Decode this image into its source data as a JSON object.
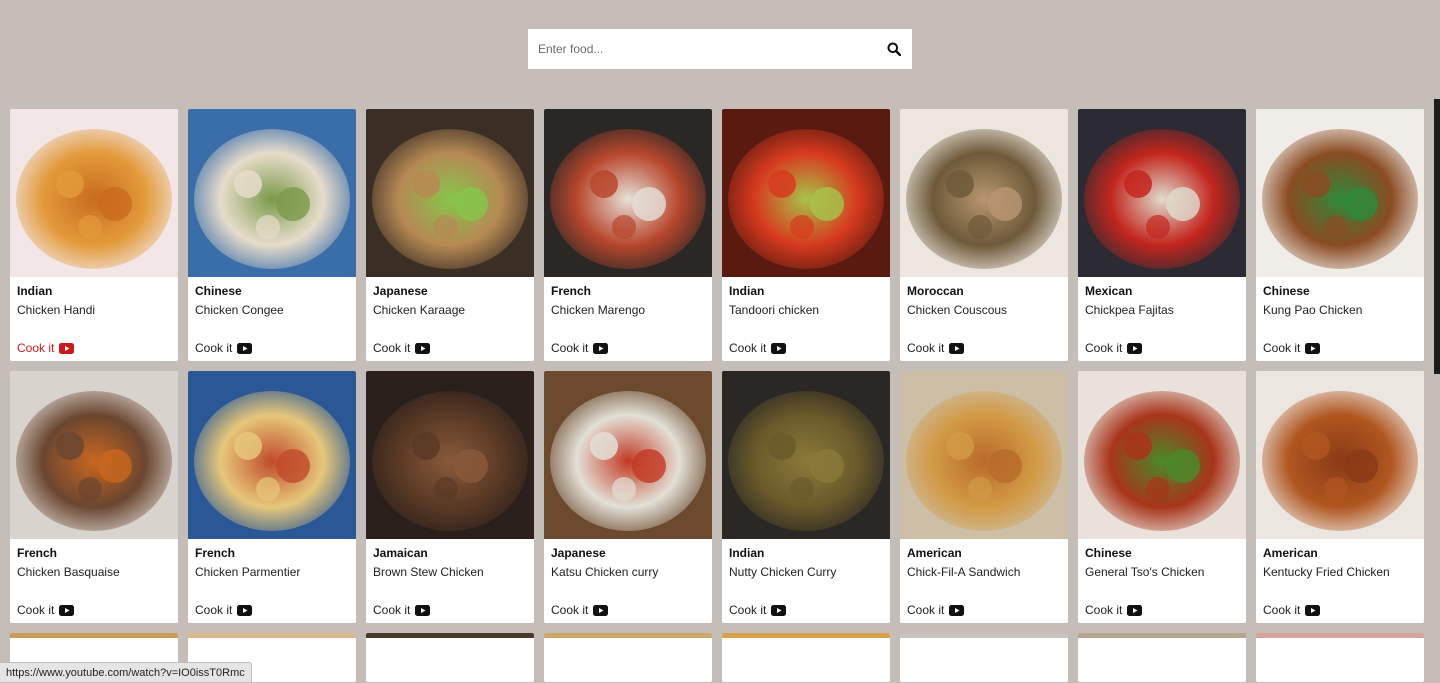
{
  "search": {
    "placeholder": "Enter food..."
  },
  "cook_label": "Cook it",
  "status_url": "https://www.youtube.com/watch?v=IO0issT0Rmc",
  "accent_color": "#cc1a1a",
  "cards": [
    {
      "cuisine": "Indian",
      "dish": "Chicken Handi",
      "colors": [
        "#f2e7e6",
        "#e39a3a",
        "#c86b1d"
      ]
    },
    {
      "cuisine": "Chinese",
      "dish": "Chicken Congee",
      "colors": [
        "#3a6ea9",
        "#e7dccb",
        "#7a9a4a"
      ]
    },
    {
      "cuisine": "Japanese",
      "dish": "Chicken Karaage",
      "colors": [
        "#3a2e25",
        "#b78954",
        "#86c54a"
      ]
    },
    {
      "cuisine": "French",
      "dish": "Chicken Marengo",
      "colors": [
        "#2b2724",
        "#b8472d",
        "#e6e0d8"
      ]
    },
    {
      "cuisine": "Indian",
      "dish": "Tandoori chicken",
      "colors": [
        "#5a1a10",
        "#d73a1e",
        "#a8c34a"
      ]
    },
    {
      "cuisine": "Moroccan",
      "dish": "Chicken Couscous",
      "colors": [
        "#ece6df",
        "#6e5a3a",
        "#b89770"
      ]
    },
    {
      "cuisine": "Mexican",
      "dish": "Chickpea Fajitas",
      "colors": [
        "#2c2a33",
        "#c3261d",
        "#e0dccf"
      ]
    },
    {
      "cuisine": "Chinese",
      "dish": "Kung Pao Chicken",
      "colors": [
        "#f0ece8",
        "#8a4b22",
        "#2e8a3a"
      ]
    },
    {
      "cuisine": "French",
      "dish": "Chicken Basquaise",
      "colors": [
        "#d8d3cc",
        "#6b4630",
        "#c9671f"
      ]
    },
    {
      "cuisine": "French",
      "dish": "Chicken Parmentier",
      "colors": [
        "#2a5896",
        "#e6c77a",
        "#c04a2a"
      ]
    },
    {
      "cuisine": "Jamaican",
      "dish": "Brown Stew Chicken",
      "colors": [
        "#2a1f1b",
        "#5a3a25",
        "#8a5a3a"
      ]
    },
    {
      "cuisine": "Japanese",
      "dish": "Katsu Chicken curry",
      "colors": [
        "#6b4a2e",
        "#e3e0d6",
        "#c23a24"
      ]
    },
    {
      "cuisine": "Indian",
      "dish": "Nutty Chicken Curry",
      "colors": [
        "#2a2724",
        "#6a5a2a",
        "#8a7a3a"
      ]
    },
    {
      "cuisine": "American",
      "dish": "Chick-Fil-A Sandwich",
      "colors": [
        "#cdbfa5",
        "#d29a45",
        "#b86a2a"
      ]
    },
    {
      "cuisine": "Chinese",
      "dish": "General Tso's Chicken",
      "colors": [
        "#e8e2da",
        "#a8341a",
        "#4a8a2a"
      ]
    },
    {
      "cuisine": "American",
      "dish": "Kentucky Fried Chicken",
      "colors": [
        "#ece6e0",
        "#b0561f",
        "#8a3a18"
      ]
    }
  ],
  "peek_colors": [
    "#c99b56",
    "#d9b88a",
    "#4a3a2a",
    "#c9a86a",
    "#d6a24a",
    "#c9c3bb",
    "#b4a58e",
    "#d6a49a"
  ]
}
